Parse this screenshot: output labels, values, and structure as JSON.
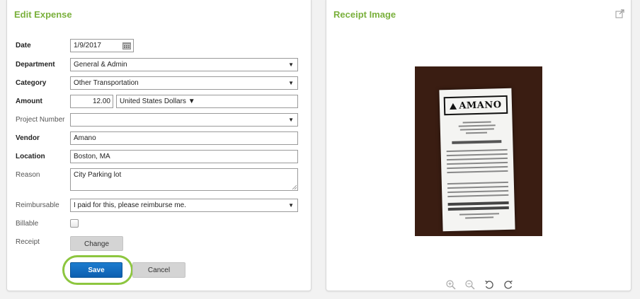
{
  "edit_expense": {
    "title": "Edit Expense",
    "fields": {
      "date": {
        "label": "Date",
        "value": "1/9/2017"
      },
      "department": {
        "label": "Department",
        "value": "General & Admin"
      },
      "category": {
        "label": "Category",
        "value": "Other Transportation"
      },
      "amount": {
        "label": "Amount",
        "value": "12.00",
        "currency": "United States Dollars"
      },
      "project_number": {
        "label": "Project Number",
        "value": ""
      },
      "vendor": {
        "label": "Vendor",
        "value": "Amano"
      },
      "location": {
        "label": "Location",
        "value": "Boston, MA"
      },
      "reason": {
        "label": "Reason",
        "value": "City Parking lot"
      },
      "reimbursable": {
        "label": "Reimbursable",
        "value": "I paid for this, please reimburse me."
      },
      "billable": {
        "label": "Billable",
        "checked": false
      },
      "receipt": {
        "label": "Receipt",
        "button": "Change"
      }
    },
    "actions": {
      "save": "Save",
      "cancel": "Cancel"
    },
    "accent_color": "#7ab03c",
    "save_color": "#0d5fb0",
    "highlight_color": "#8dc63f"
  },
  "receipt_image": {
    "title": "Receipt Image",
    "logo_text": "AMANO",
    "icons": [
      "external-link-icon",
      "zoom-in-icon",
      "zoom-out-icon",
      "rotate-left-icon",
      "rotate-right-icon"
    ]
  }
}
